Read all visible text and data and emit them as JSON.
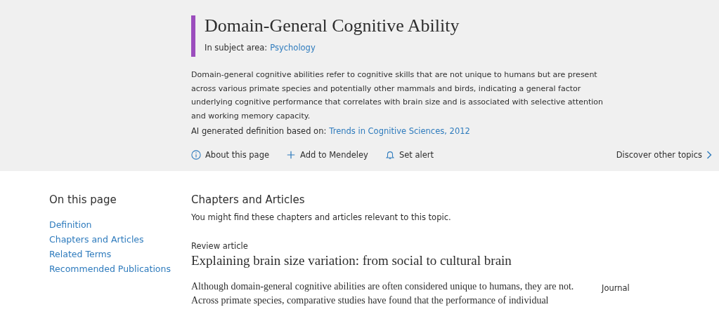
{
  "topic": {
    "title": "Domain-General Cognitive Ability",
    "subject_label": "In subject area:",
    "subject_link": "Psychology",
    "definition": "Domain-general cognitive abilities refer to cognitive skills that are not unique to humans but are present across various primate species and potentially other mammals and birds, indicating a general factor underlying cognitive performance that correlates with brain size and is associated with selective attention and working memory capacity.",
    "source_label": "AI generated definition based on:",
    "source_link": "Trends in Cognitive Sciences, 2012",
    "actions": [
      {
        "kind": "info",
        "label": "About this page"
      },
      {
        "kind": "plus",
        "label": "Add to Mendeley"
      },
      {
        "kind": "bell",
        "label": "Set alert"
      }
    ],
    "discover": "Discover other topics"
  },
  "sidebar": {
    "heading": "On this page",
    "items": [
      "Definition",
      "Chapters and Articles",
      "Related Terms",
      "Recommended Publications"
    ]
  },
  "section": {
    "heading": "Chapters and Articles",
    "intro": "You might find these chapters and articles relevant to this topic.",
    "article": {
      "type": "Review article",
      "title": "Explaining brain size variation: from social to cultural brain",
      "abstract": "Although domain-general cognitive abilities are often considered unique to humans, they are not. Across primate species, comparative studies have found that the performance of individual",
      "source_type": "Journal"
    }
  }
}
